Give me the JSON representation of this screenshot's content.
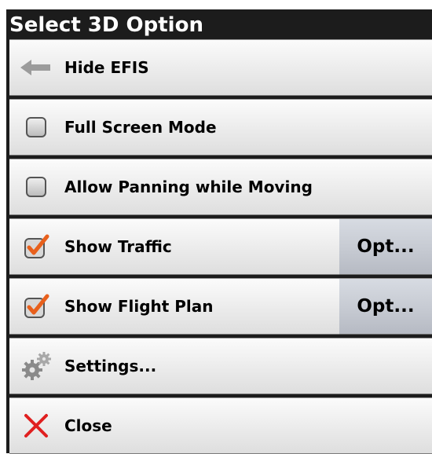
{
  "title": "Select 3D Option",
  "items": [
    {
      "label": "Hide EFIS",
      "icon": "arrow-left-icon"
    },
    {
      "label": "Full Screen Mode",
      "icon": "checkbox-icon",
      "checked": false
    },
    {
      "label": "Allow Panning while Moving",
      "icon": "checkbox-icon",
      "checked": false
    },
    {
      "label": "Show Traffic",
      "icon": "checkbox-icon",
      "checked": true,
      "options_label": "Opt..."
    },
    {
      "label": "Show Flight Plan",
      "icon": "checkbox-icon",
      "checked": true,
      "options_label": "Opt..."
    },
    {
      "label": "Settings...",
      "icon": "gears-icon"
    },
    {
      "label": "Close",
      "icon": "close-x-icon"
    }
  ],
  "colors": {
    "title_bar": "#1c1c1c",
    "check_mark": "#e8601c",
    "close_x": "#e02020",
    "options_button": "#c6cad2"
  }
}
